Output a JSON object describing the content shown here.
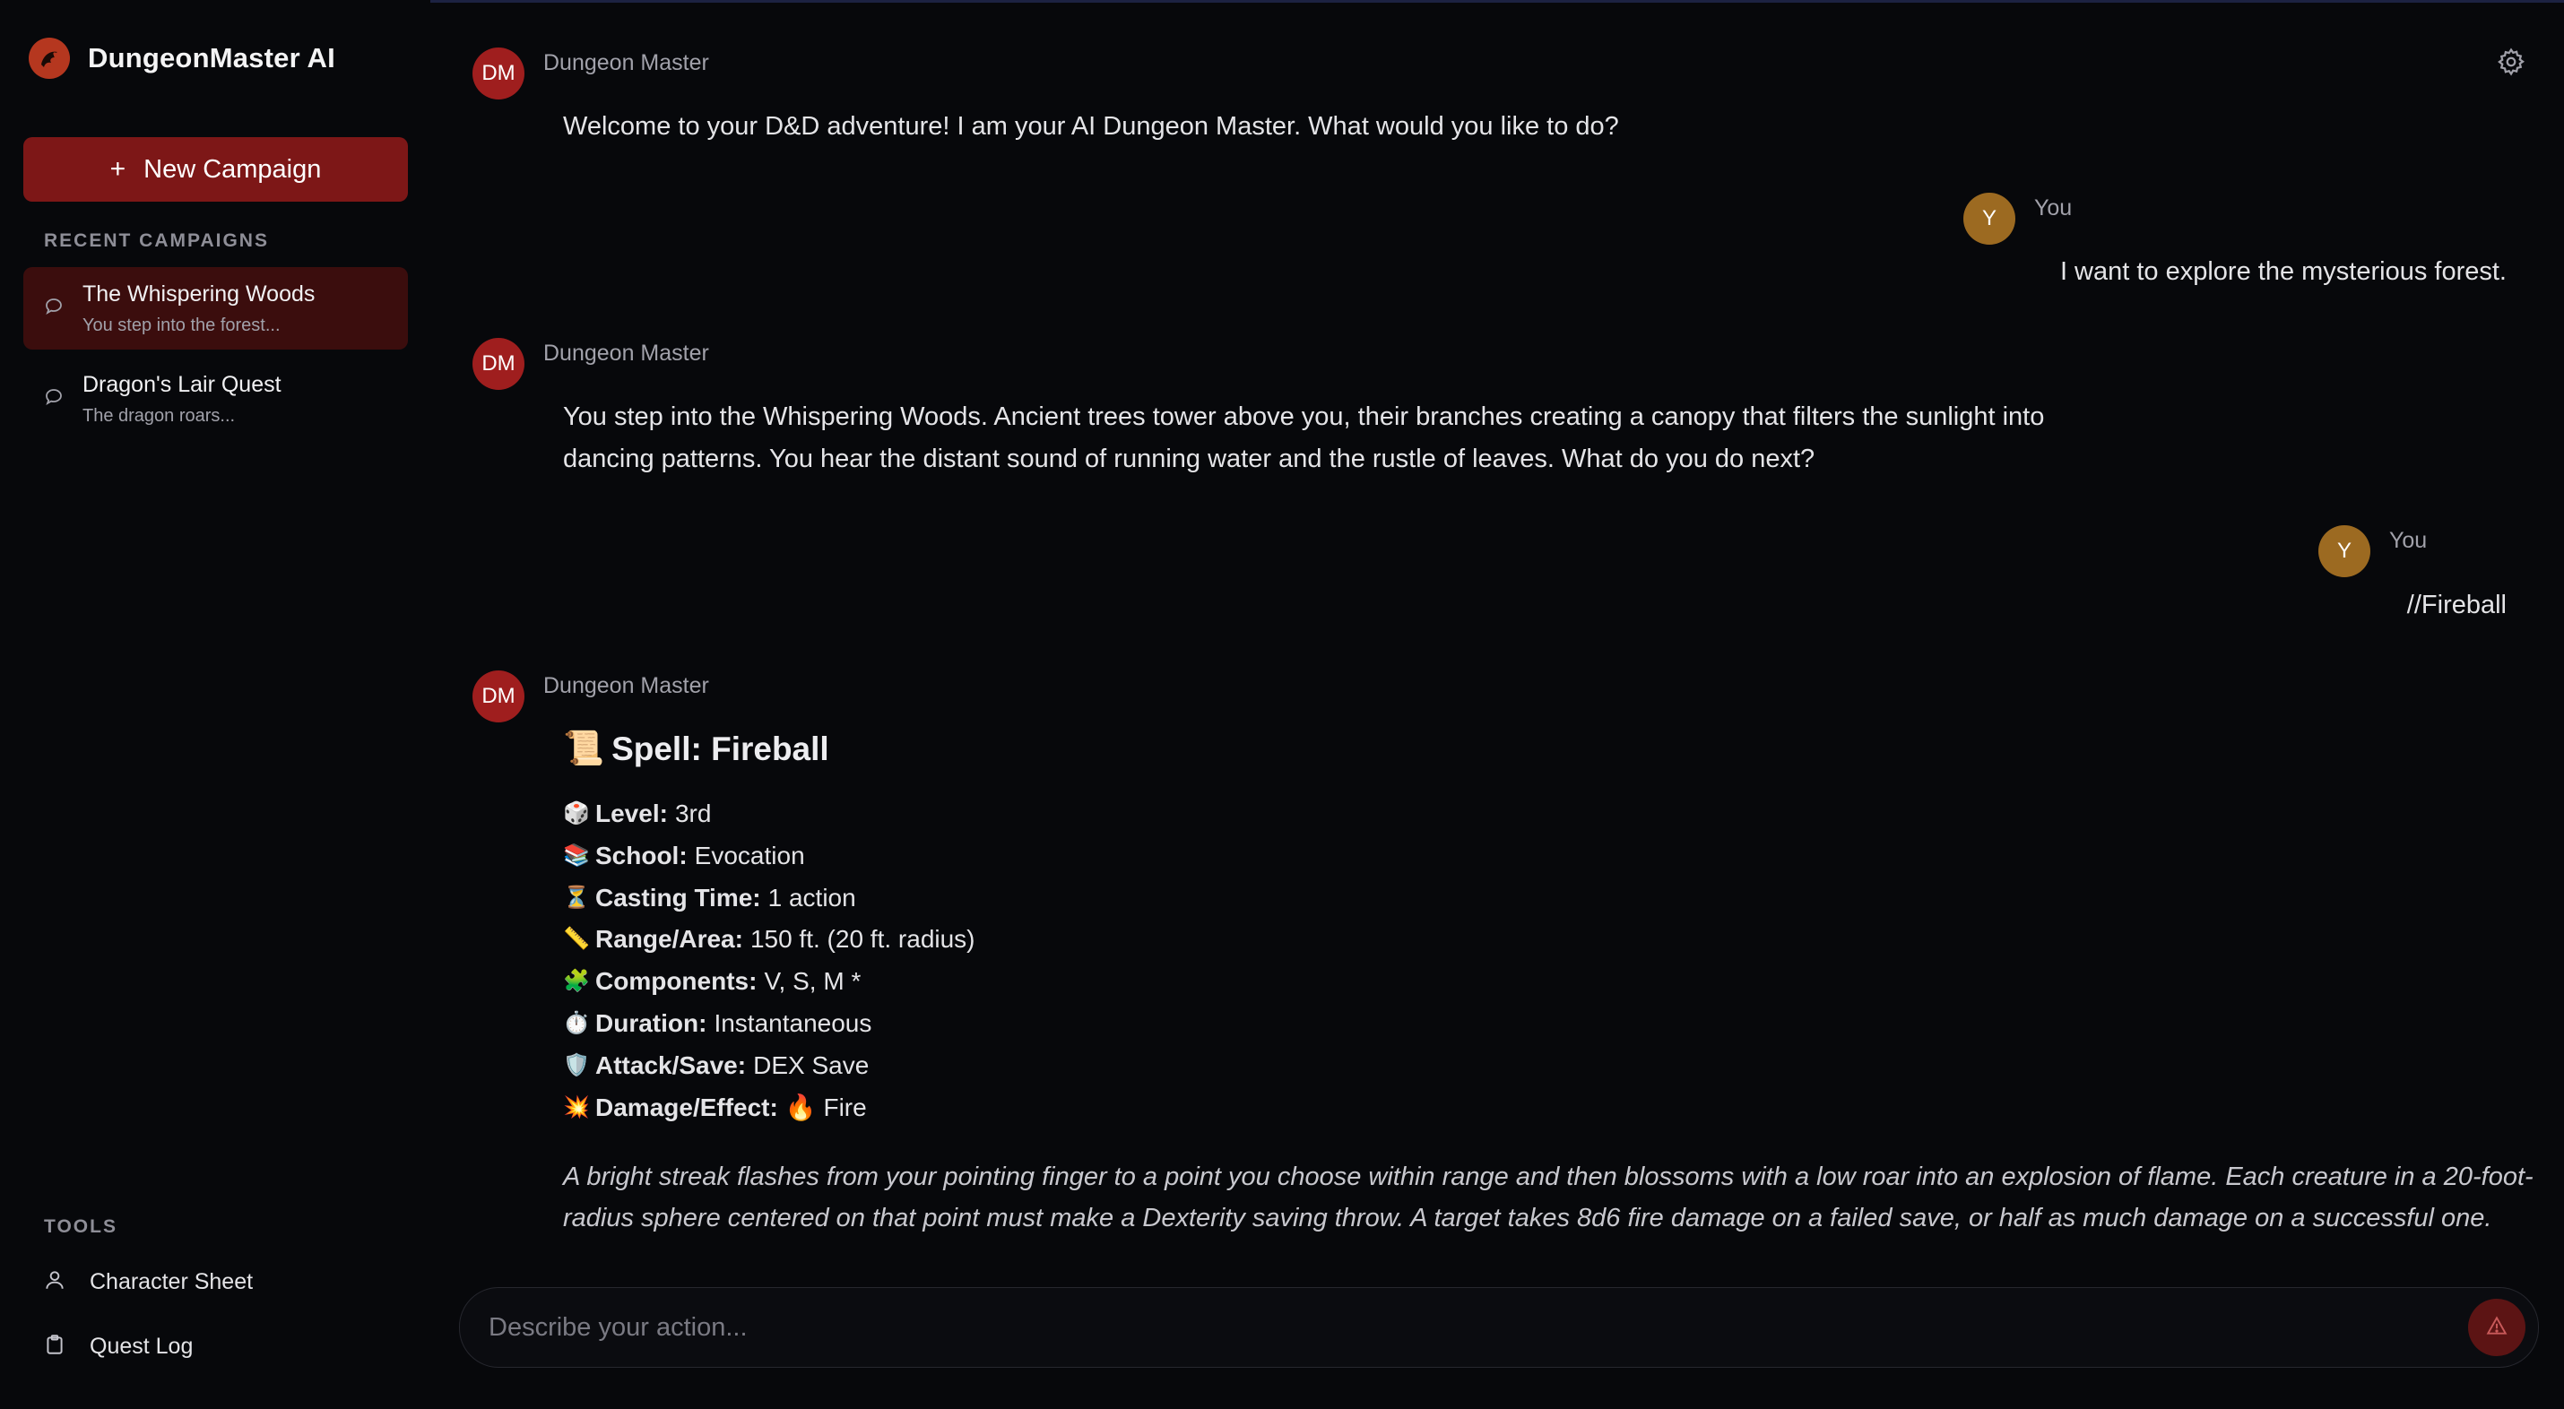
{
  "app": {
    "title": "DungeonMaster AI"
  },
  "sidebar": {
    "new_campaign_label": "New Campaign",
    "recent_label": "RECENT CAMPAIGNS",
    "campaigns": [
      {
        "title": "The Whispering Woods",
        "preview": "You step into the forest...",
        "active": true
      },
      {
        "title": "Dragon's Lair Quest",
        "preview": "The dragon roars...",
        "active": false
      }
    ],
    "tools_label": "TOOLS",
    "tools": [
      {
        "label": "Character Sheet",
        "icon": "user-icon"
      },
      {
        "label": "Quest Log",
        "icon": "clipboard-icon"
      }
    ]
  },
  "chat": {
    "dm_initials": "DM",
    "dm_name": "Dungeon Master",
    "user_initial": "Y",
    "user_name": "You",
    "messages": [
      {
        "role": "dm",
        "text": "Welcome to your D&D adventure! I am your AI Dungeon Master. What would you like to do?"
      },
      {
        "role": "user",
        "text": "I want to explore the mysterious forest."
      },
      {
        "role": "dm",
        "text": "You step into the Whispering Woods. Ancient trees tower above you, their branches creating a canopy that filters the sunlight into dancing patterns. You hear the distant sound of running water and the rustle of leaves. What do you do next?"
      },
      {
        "role": "user",
        "text": "//Fireball"
      }
    ],
    "spell": {
      "title_emoji": "📜",
      "title": "Spell: Fireball",
      "fields": [
        {
          "emoji": "🎲",
          "label": "Level:",
          "value": "3rd"
        },
        {
          "emoji": "📚",
          "label": "School:",
          "value": "Evocation"
        },
        {
          "emoji": "⏳",
          "label": "Casting Time:",
          "value": "1 action"
        },
        {
          "emoji": "📏",
          "label": "Range/Area:",
          "value": "150 ft. (20 ft. radius)"
        },
        {
          "emoji": "🧩",
          "label": "Components:",
          "value": "V, S, M *"
        },
        {
          "emoji": "⏱️",
          "label": "Duration:",
          "value": "Instantaneous"
        },
        {
          "emoji": "🛡️",
          "label": "Attack/Save:",
          "value": "DEX Save"
        },
        {
          "emoji": "💥",
          "label": "Damage/Effect:",
          "value": "🔥 Fire"
        }
      ],
      "description": "A bright streak flashes from your pointing finger to a point you choose within range and then blossoms with a low roar into an explosion of flame. Each creature in a 20-foot-radius sphere centered on that point must make a Dexterity saving throw. A target takes 8d6 fire damage on a failed save, or half as much damage on a successful one."
    }
  },
  "composer": {
    "placeholder": "Describe your action...",
    "send_icon": "warning-icon"
  },
  "colors": {
    "accent": "#7d1717",
    "dm_avatar": "#9f1e1e",
    "user_avatar": "#9c6a21",
    "background": "#07080b"
  }
}
